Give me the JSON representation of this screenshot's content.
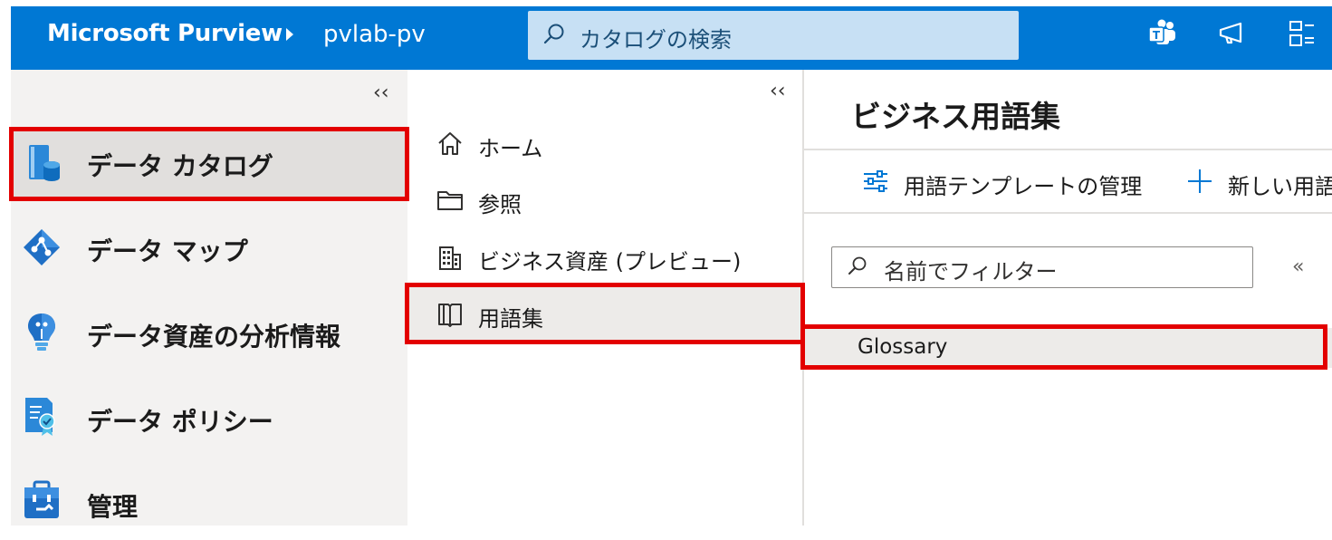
{
  "header": {
    "brand": "Microsoft Purview",
    "account": "pvlab-pv",
    "search_placeholder": "カタログの検索",
    "icons": [
      "teams-icon",
      "feedback-megaphone-icon",
      "directory-switch-icon"
    ]
  },
  "left_nav": {
    "collapse": "‹‹",
    "items": [
      {
        "label": "データ カタログ",
        "icon": "data-catalog-icon",
        "selected": true
      },
      {
        "label": "データ マップ",
        "icon": "data-map-icon"
      },
      {
        "label": "データ資産の分析情報",
        "icon": "lightbulb-insights-icon"
      },
      {
        "label": "データ ポリシー",
        "icon": "policy-document-icon"
      },
      {
        "label": "管理",
        "icon": "toolbox-icon"
      }
    ]
  },
  "catalog_nav": {
    "collapse": "‹‹",
    "items": [
      {
        "label": "ホーム",
        "icon": "home-icon"
      },
      {
        "label": "参照",
        "icon": "folder-icon"
      },
      {
        "label": "ビジネス資産 (プレビュー)",
        "icon": "building-icon"
      },
      {
        "label": "用語集",
        "icon": "book-icon",
        "selected": true
      }
    ]
  },
  "main": {
    "title": "ビジネス用語集",
    "toolbar": {
      "manage_templates": "用語テンプレートの管理",
      "new_term": "新しい用語"
    },
    "filter_placeholder": "名前でフィルター",
    "collapse": "«",
    "glossaries": [
      "Glossary"
    ]
  },
  "colors": {
    "header_bg": "#0078d4",
    "highlight_box": "#e30000",
    "accent": "#0078d4"
  }
}
